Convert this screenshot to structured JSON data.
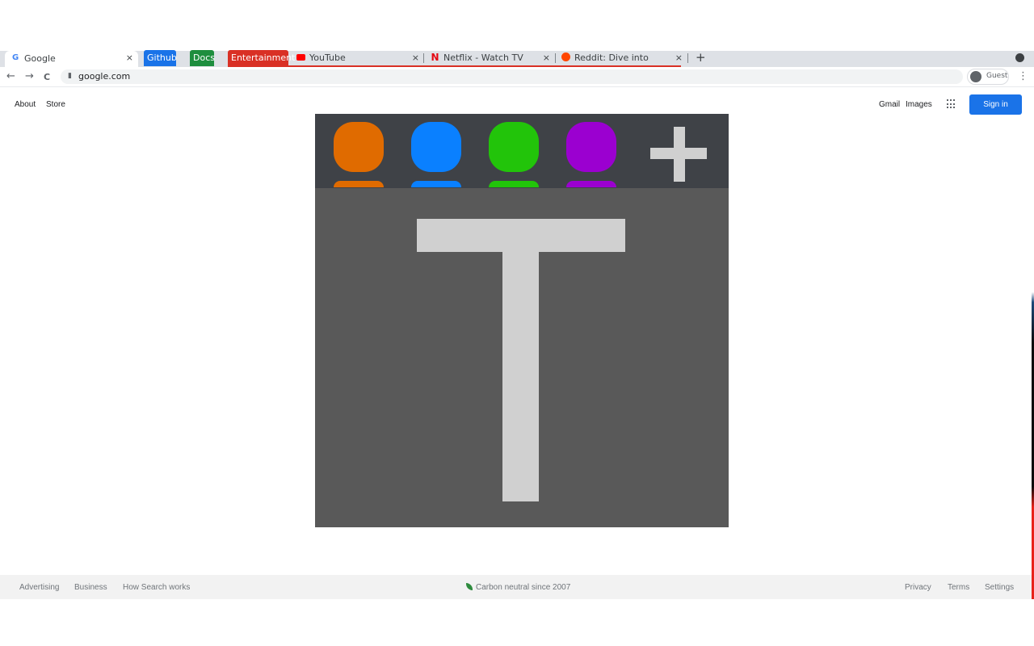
{
  "browser": {
    "active_tab": {
      "favicon": "G",
      "title": "Google",
      "close": "×"
    },
    "tab_groups": [
      {
        "label": "Github",
        "color": "#1a73e8"
      },
      {
        "label": "Docs",
        "color": "#1e8e3e"
      },
      {
        "label": "Entertainment",
        "color": "#d93025"
      }
    ],
    "tabs": [
      {
        "title": "YouTube",
        "icon": "youtube-icon",
        "close": "×"
      },
      {
        "title": "Netflix - Watch TV Shows",
        "icon": "netflix-icon",
        "favicon": "N",
        "close": "×"
      },
      {
        "title": "Reddit: Dive into anything",
        "icon": "reddit-icon",
        "close": "×"
      }
    ],
    "new_tab": "+",
    "nav": {
      "back": "←",
      "forward": "→",
      "reload": "C"
    },
    "url": "google.com",
    "lock_icon": "🔒",
    "profile_label": "Guest",
    "menu": "⋮"
  },
  "google": {
    "top_left_links": [
      "About",
      "Store"
    ],
    "top_right_links": [
      "Gmail",
      "Images"
    ],
    "sign_in": "Sign in",
    "hero_image": {
      "description": "Placeholder image with four colored user avatars and a plus sign above a large letter T",
      "avatar_colors": [
        "#e06b00",
        "#0a80ff",
        "#22c40a",
        "#9b00d0"
      ],
      "letter": "T"
    },
    "footer": {
      "left_links": [
        "Advertising",
        "Business",
        "How Search works"
      ],
      "center": "Carbon neutral since 2007",
      "right_links": [
        "Privacy",
        "Terms",
        "Settings"
      ]
    }
  }
}
